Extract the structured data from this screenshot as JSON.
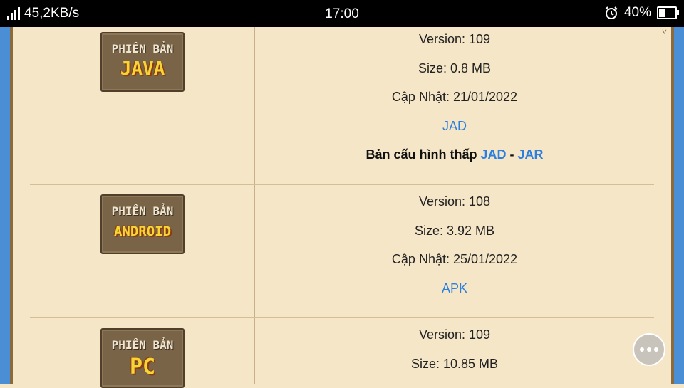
{
  "status_bar": {
    "speed": "45,2KB/s",
    "time": "17:00",
    "battery": "40%",
    "battery_level": 0.4
  },
  "versions": [
    {
      "badge_top": "PHIÊN BẢN",
      "badge_name": "JAVA",
      "version": "Version: 109",
      "size": "Size: 0.8 MB",
      "updated": "Cập Nhật: 21/01/2022",
      "download": "JAD",
      "lowconfig_label": "Bản cấu hình thấp",
      "lowconfig_link1": "JAD",
      "lowconfig_sep": "-",
      "lowconfig_link2": "JAR"
    },
    {
      "badge_top": "PHIÊN BẢN",
      "badge_name": "ANDROID",
      "version": "Version: 108",
      "size": "Size: 3.92 MB",
      "updated": "Cập Nhật: 25/01/2022",
      "download": "APK"
    },
    {
      "badge_top": "PHIÊN BẢN",
      "badge_name": "PC",
      "version": "Version: 109",
      "size": "Size: 10.85 MB"
    }
  ],
  "colors": {
    "link": "#2b7fe0",
    "background": "#f6e6c8",
    "frame": "#4a8fd6"
  }
}
